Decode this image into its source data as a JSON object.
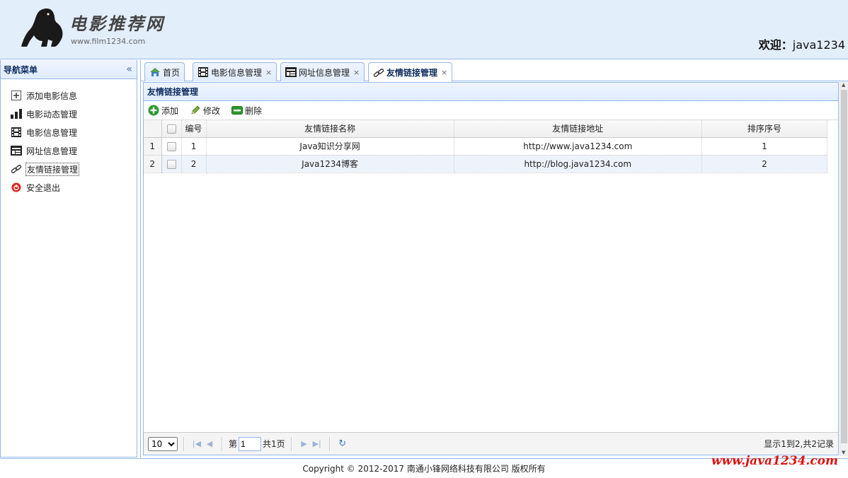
{
  "header": {
    "logo_title": "电影推荐网",
    "logo_url": "www.film1234.com",
    "welcome_label": "欢迎：",
    "username": "java1234"
  },
  "sidebar": {
    "title": "导航菜单",
    "collapse_icon": "double-chevron-left-icon",
    "items": [
      {
        "label": "添加电影信息",
        "icon": "add-icon"
      },
      {
        "label": "电影动态管理",
        "icon": "bar-chart-icon"
      },
      {
        "label": "电影信息管理",
        "icon": "film-icon"
      },
      {
        "label": "网址信息管理",
        "icon": "web-page-icon"
      },
      {
        "label": "友情链接管理",
        "icon": "link-icon"
      },
      {
        "label": "安全退出",
        "icon": "power-icon"
      }
    ]
  },
  "tabs": [
    {
      "label": "首页",
      "icon": "home-icon"
    },
    {
      "label": "电影信息管理",
      "icon": "film-icon"
    },
    {
      "label": "网址信息管理",
      "icon": "web-page-icon"
    },
    {
      "label": "友情链接管理",
      "icon": "link-icon"
    }
  ],
  "panel": {
    "title": "友情链接管理",
    "toolbar": {
      "add": "添加",
      "edit": "修改",
      "delete": "删除"
    },
    "columns": {
      "id": "编号",
      "name": "友情链接名称",
      "url": "友情链接地址",
      "order": "排序序号"
    },
    "rows": [
      {
        "rownum": "1",
        "id": "1",
        "name": "Java知识分享网",
        "url": "http://www.java1234.com",
        "order": "1"
      },
      {
        "rownum": "2",
        "id": "2",
        "name": "Java1234博客",
        "url": "http://blog.java1234.com",
        "order": "2"
      }
    ]
  },
  "pager": {
    "page_size": "10",
    "page_prefix": "第",
    "page_value": "1",
    "page_suffix": "共1页",
    "info": "显示1到2,共2记录"
  },
  "footer": {
    "copyright": "Copyright © 2012-2017 南通小锋网络科技有限公司 版权所有",
    "watermark": "www.java1234.com"
  },
  "colors": {
    "header_bg": "#e3eefb",
    "border": "#95b8e7",
    "watermark": "#e01010"
  }
}
